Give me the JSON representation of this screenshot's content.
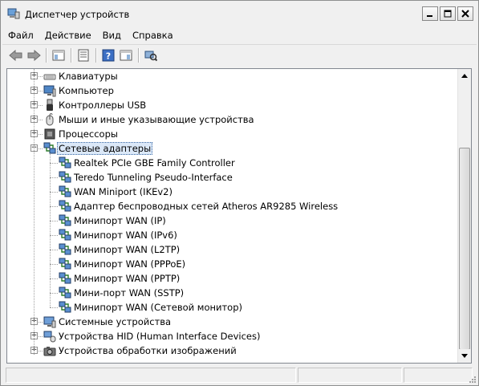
{
  "window": {
    "title": "Диспетчер устройств",
    "buttons": [
      "minimize",
      "maximize",
      "close"
    ]
  },
  "menu": {
    "items": [
      "Файл",
      "Действие",
      "Вид",
      "Справка"
    ]
  },
  "toolbar": {
    "buttons": [
      {
        "icon": "back-arrow-icon"
      },
      {
        "icon": "forward-arrow-icon"
      },
      {
        "icon": "show-hide-console-tree-icon"
      },
      {
        "icon": "properties-icon"
      },
      {
        "icon": "help-icon"
      },
      {
        "icon": "show-hide-action-pane-icon"
      },
      {
        "icon": "scan-hardware-changes-icon"
      }
    ]
  },
  "tree": {
    "top_nodes_before": [
      {
        "label": "Клавиатуры",
        "icon": "keyboard-icon",
        "expanded": false
      },
      {
        "label": "Компьютер",
        "icon": "computer-icon",
        "expanded": false
      },
      {
        "label": "Контроллеры USB",
        "icon": "usb-icon",
        "expanded": false
      },
      {
        "label": "Мыши и иные указывающие устройства",
        "icon": "mouse-icon",
        "expanded": false
      },
      {
        "label": "Процессоры",
        "icon": "processor-icon",
        "expanded": false
      }
    ],
    "selected_node": {
      "label": "Сетевые адаптеры",
      "icon": "network-adapter-icon",
      "expanded": true
    },
    "children": [
      "Realtek PCIe GBE Family Controller",
      "Teredo Tunneling Pseudo-Interface",
      "WAN Miniport (IKEv2)",
      "Адаптер беспроводных сетей Atheros AR9285 Wireless",
      "Минипорт WAN (IP)",
      "Минипорт WAN (IPv6)",
      "Минипорт WAN (L2TP)",
      "Минипорт WAN (PPPoE)",
      "Минипорт WAN (PPTP)",
      "Мини-порт WAN (SSTP)",
      "Минипорт WAN (Сетевой монитор)"
    ],
    "top_nodes_after": [
      {
        "label": "Системные устройства",
        "icon": "system-devices-icon",
        "expanded": false
      },
      {
        "label": "Устройства HID (Human Interface Devices)",
        "icon": "hid-icon",
        "expanded": false
      },
      {
        "label": "Устройства обработки изображений",
        "icon": "imaging-device-icon",
        "expanded": false
      }
    ]
  },
  "colors": {
    "selection_bg": "#dbe8f8",
    "selection_border": "#3b6aa5",
    "window_bg": "#f0f0f0"
  }
}
